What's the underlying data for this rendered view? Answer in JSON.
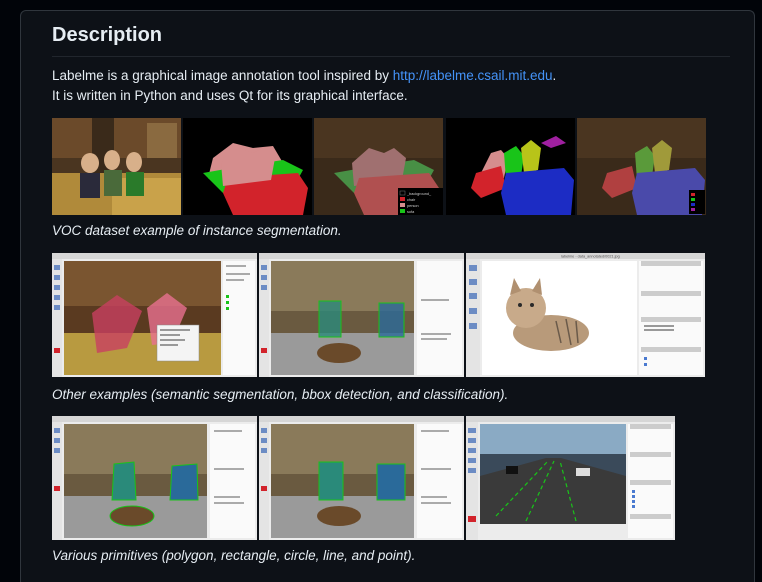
{
  "heading": "Description",
  "intro": {
    "text1": "Labelme is a graphical image annotation tool inspired by ",
    "link": "http://labelme.csail.mit.edu",
    "text1_end": ".",
    "text2": "It is written in Python and uses Qt for its graphical interface."
  },
  "captions": {
    "voc": "VOC dataset example of instance segmentation.",
    "other": "Other examples (semantic segmentation, bbox detection, and classification).",
    "primitives": "Various primitives (polygon, rectangle, circle, line, and point)."
  },
  "legend_labels": [
    "_background_",
    "chair",
    "person",
    "sofa"
  ],
  "app_title": "labelme - data_annotated/0021.jpg",
  "colors": {
    "accent_link": "#4493f8",
    "mask_red": "#d2232b",
    "mask_green": "#19c419",
    "mask_blue": "#1c2cc4",
    "mask_pink": "#d58d8d"
  }
}
